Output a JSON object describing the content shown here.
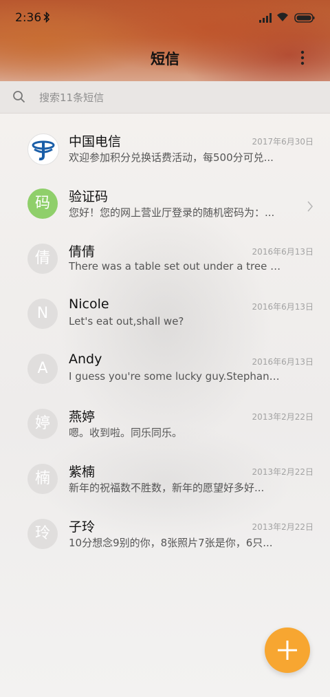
{
  "status_bar": {
    "time": "2:36"
  },
  "header": {
    "title": "短信"
  },
  "search": {
    "placeholder": "搜索11条短信"
  },
  "conversations": [
    {
      "name": "中国电信",
      "preview": "欢迎参加积分兑换话费活动，每500分可兑...",
      "date": "2017年6月30日",
      "avatar_icon": "china-telecom-logo"
    },
    {
      "name": "验证码",
      "preview": "您好！您的网上营业厅登录的随机密码为：...",
      "date": "",
      "avatar_text": "码"
    },
    {
      "name": "倩倩",
      "preview": "There was a table set out under a tree in...",
      "date": "2016年6月13日",
      "avatar_text": "倩"
    },
    {
      "name": "Nicole",
      "preview": "Let's eat out,shall we?",
      "date": "2016年6月13日",
      "avatar_text": "N"
    },
    {
      "name": "Andy",
      "preview": "I guess you're some lucky guy.Stephani...",
      "date": "2016年6月13日",
      "avatar_text": "A"
    },
    {
      "name": "燕婷",
      "preview": "嗯。收到啦。同乐同乐。",
      "date": "2013年2月22日",
      "avatar_text": "婷"
    },
    {
      "name": "紫楠",
      "preview": "新年的祝福数不胜数，新年的愿望好多好...",
      "date": "2013年2月22日",
      "avatar_text": "楠"
    },
    {
      "name": "子玲",
      "preview": "10分想念9别的你，8张照片7张是你，6只...",
      "date": "2013年2月22日",
      "avatar_text": "玲"
    }
  ],
  "colors": {
    "fab": "#f7a631",
    "verification_avatar": "#8fcf6a",
    "header": "#c56a3b"
  }
}
